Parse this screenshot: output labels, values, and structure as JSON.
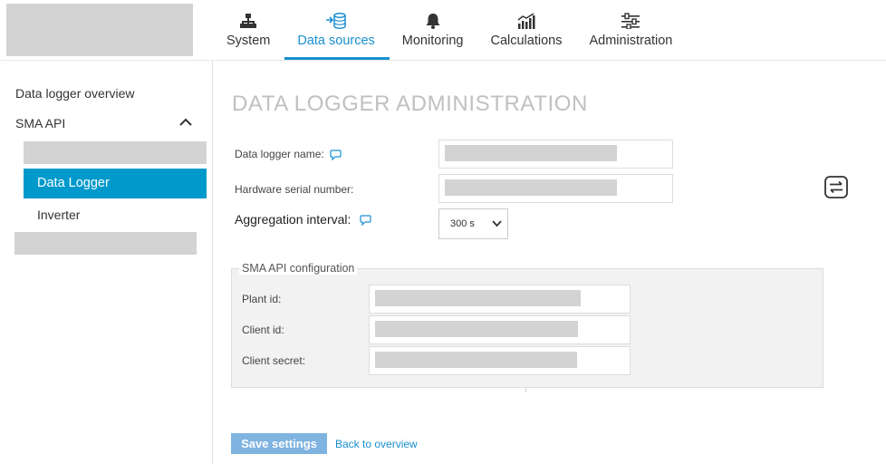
{
  "nav": {
    "items": [
      {
        "label": "System",
        "icon": "sitemap-icon"
      },
      {
        "label": "Data sources",
        "icon": "database-import-icon",
        "active": true
      },
      {
        "label": "Monitoring",
        "icon": "bell-icon"
      },
      {
        "label": "Calculations",
        "icon": "chart-icon"
      },
      {
        "label": "Administration",
        "icon": "sliders-icon"
      }
    ],
    "accent_color": "#1a8fd0"
  },
  "sidebar": {
    "overview_label": "Data logger overview",
    "group_label": "SMA API",
    "active_label": "Data Logger",
    "inverter_label": "Inverter",
    "active_color": "#0099cc"
  },
  "main": {
    "title": "DATA LOGGER ADMINISTRATION",
    "labels": {
      "name": "Data logger name:",
      "serial": "Hardware serial number:",
      "interval": "Aggregation interval:"
    },
    "interval_value": "300 s",
    "sma_config": {
      "legend": "SMA API configuration",
      "plant_label": "Plant id:",
      "client_label": "Client id:",
      "secret_label": "Client secret:"
    },
    "save_label": "Save settings",
    "back_label": "Back to overview"
  }
}
